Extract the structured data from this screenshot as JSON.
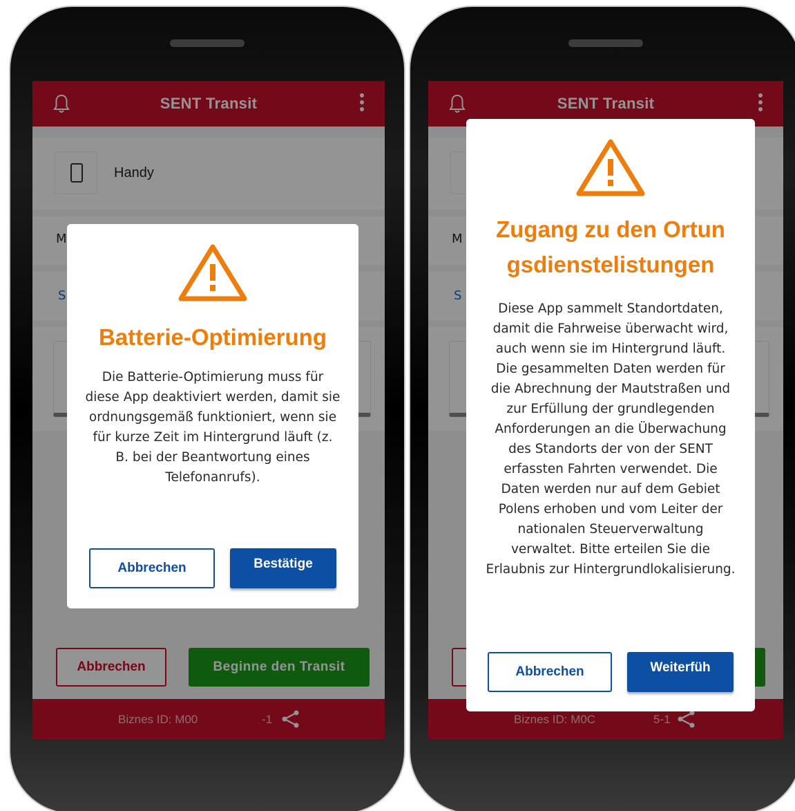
{
  "app": {
    "title": "SENT Transit"
  },
  "left_screen": {
    "device_label": "Handy",
    "row2_initial": "M",
    "row3_initial": "S",
    "buttons": {
      "cancel": "Abbrechen",
      "start": "Beginne den Transit"
    },
    "footer": {
      "biznes": "Biznes ID:  M00",
      "tail": "-1"
    },
    "dialog": {
      "title": "Batterie-Optimierung",
      "body": "Die Batterie-Optimierung muss für diese App deaktiviert werden, damit sie ordnungsgemäß funktioniert, wenn sie für kurze Zeit im Hintergrund läuft (z. B. bei der Beantwortung eines Telefonanrufs).",
      "cancel": "Abbrechen",
      "confirm": "Bestätige"
    }
  },
  "right_screen": {
    "row2_initial": "M",
    "row3_initial": "S",
    "footer": {
      "biznes": "Biznes ID:  M0C",
      "tail": "5-1"
    },
    "dialog": {
      "title": "Zugang zu den Ortungsdienstelistungen",
      "body": "Diese App sammelt Standortdaten, damit die Fahrweise überwacht wird, auch wenn sie im Hintergrund läuft. Die gesammelten Daten werden für die Abrechnung der Mautstraßen und zur Erfüllung der grundlegenden Anforderungen an die Überwachung des Standorts der von der SENT erfassten Fahrten verwendet. Die Daten werden nur auf dem Gebiet Polens erhoben und vom Leiter der nationalen Steuerverwaltung verwaltet. Bitte erteilen Sie die Erlaubnis zur Hintergrundlokalisierung.",
      "cancel": "Abbrechen",
      "confirm": "Weiterfüh"
    }
  },
  "colors": {
    "brand_red": "#c8102e",
    "warning_orange": "#ee7d0c",
    "primary_blue": "#0d4fa3",
    "start_green": "#1b9c1b"
  },
  "icons": [
    "bell-icon",
    "more-vert-icon",
    "phone-device-icon",
    "warning-icon",
    "share-icon"
  ]
}
